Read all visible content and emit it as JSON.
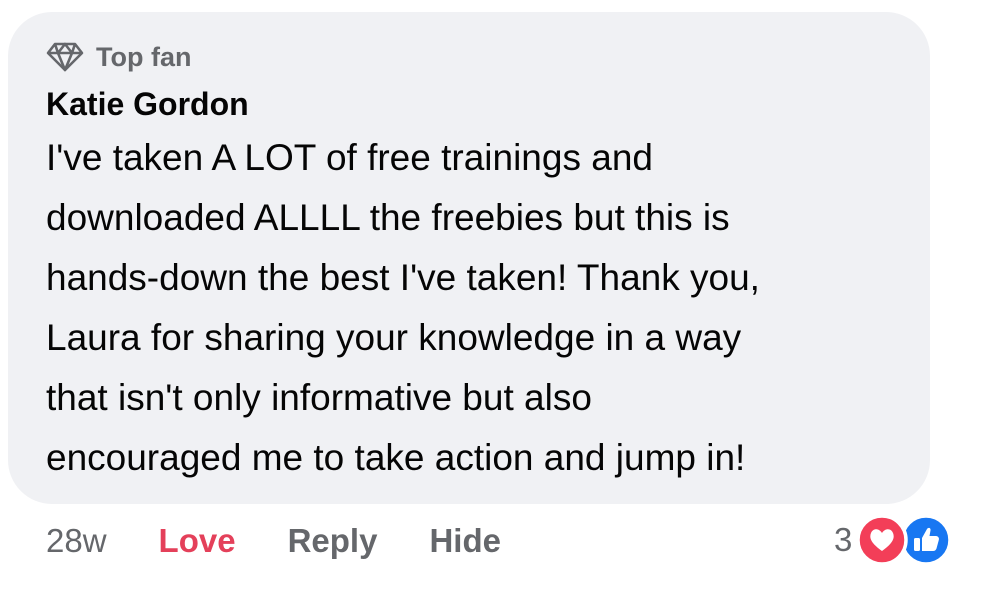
{
  "comment": {
    "badge": "Top fan",
    "badge_icon": "diamond-icon",
    "author": "Katie Gordon",
    "text_lines": [
      "I've taken A LOT of free trainings and",
      "downloaded ALLLL the freebies but this is",
      "hands-down the best I've taken! Thank you,",
      "Laura for sharing your knowledge in a way",
      "that isn't only informative but also",
      "encouraged me to take action and jump in!"
    ]
  },
  "actions": {
    "time": "28w",
    "love": "Love",
    "reply": "Reply",
    "hide": "Hide"
  },
  "reactions": {
    "count": "3",
    "icons": [
      "heart-reaction-icon",
      "like-reaction-icon"
    ]
  },
  "colors": {
    "bubble_bg": "#f0f1f4",
    "love": "#e4405a",
    "heart": "#f33e58",
    "like": "#1877f2",
    "muted": "#65676b"
  }
}
